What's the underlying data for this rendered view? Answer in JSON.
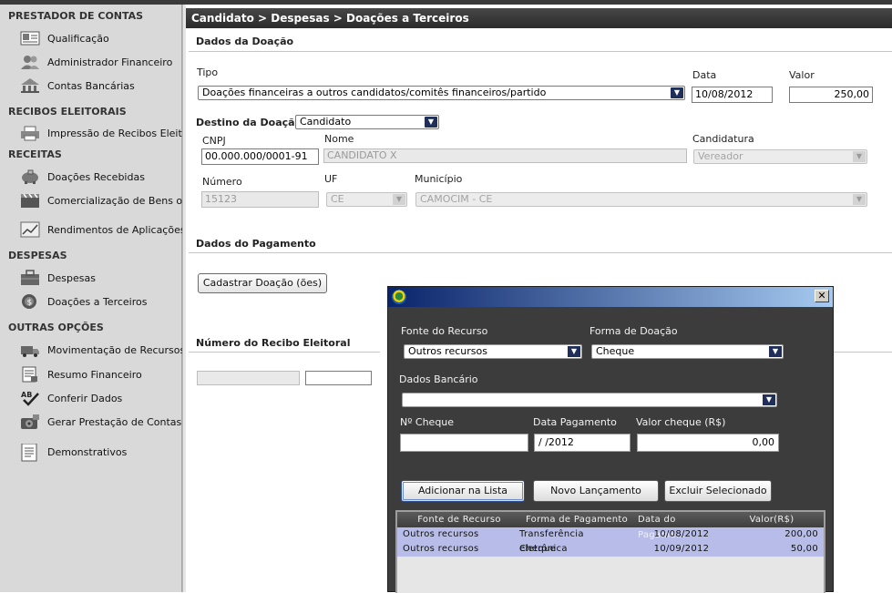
{
  "sidebar": {
    "sections": [
      {
        "title": "PRESTADOR DE CONTAS",
        "items": [
          {
            "label": "Qualificação",
            "icon": "id-card-icon"
          },
          {
            "label": "Administrador Financeiro",
            "icon": "users-icon"
          },
          {
            "label": "Contas Bancárias",
            "icon": "bank-icon"
          }
        ]
      },
      {
        "title": "RECIBOS ELEITORAIS",
        "items": [
          {
            "label": "Impressão de Recibos Eleitora",
            "icon": "printer-icon"
          }
        ]
      },
      {
        "title": "RECEITAS",
        "items": [
          {
            "label": "Doações Recebidas",
            "icon": "piggy-bank-icon"
          },
          {
            "label": "Comercialização de Bens ou R",
            "icon": "clapperboard-icon"
          },
          {
            "label": "Rendimentos de Aplicações Fi",
            "icon": "chart-icon"
          }
        ]
      },
      {
        "title": "DESPESAS",
        "items": [
          {
            "label": "Despesas",
            "icon": "briefcase-icon"
          },
          {
            "label": "Doações a Terceiros",
            "icon": "coin-icon"
          }
        ]
      },
      {
        "title": "OUTRAS OPÇÕES",
        "items": [
          {
            "label": "Movimentação de Recursos",
            "icon": "truck-icon"
          },
          {
            "label": "Resumo Financeiro",
            "icon": "report-icon"
          },
          {
            "label": "Conferir Dados",
            "icon": "spellcheck-icon"
          },
          {
            "label": "Gerar Prestação de Contas",
            "icon": "disk-icon"
          },
          {
            "label": "Demonstrativos",
            "icon": "document-icon"
          }
        ]
      }
    ]
  },
  "main": {
    "breadcrumb": "Candidato > Despesas > Doações a Terceiros",
    "dados_doacao": {
      "heading": "Dados da Doação",
      "tipo_label": "Tipo",
      "tipo_value": "Doações financeiras a outros candidatos/comitês financeiros/partido",
      "data_label": "Data",
      "data_value": "10/08/2012",
      "valor_label": "Valor",
      "valor_value": "250,00"
    },
    "destino": {
      "heading": "Destino da Doação",
      "select_value": "Candidato",
      "cnpj_label": "CNPJ",
      "cnpj_value": "00.000.000/0001-91",
      "nome_label": "Nome",
      "nome_value": "CANDIDATO X",
      "candidatura_label": "Candidatura",
      "candidatura_value": "Vereador",
      "numero_label": "Número",
      "numero_value": "15123",
      "uf_label": "UF",
      "uf_value": "CE",
      "municipio_label": "Município",
      "municipio_value": "CAMOCIM - CE"
    },
    "pagamento": {
      "heading": "Dados do Pagamento",
      "button": "Cadastrar Doação (ões)"
    },
    "recibo": {
      "heading": "Número do Recibo Eleitoral"
    }
  },
  "dialog": {
    "fonte_label": "Fonte do Recurso",
    "fonte_value": "Outros recursos",
    "forma_label": "Forma de Doação",
    "forma_value": "Cheque",
    "banco_label": "Dados Bancário",
    "banco_value": "",
    "cheque_label": "Nº Cheque",
    "cheque_value": "",
    "data_label": "Data Pagamento",
    "data_value": " /  /2012",
    "valor_label": "Valor cheque (R$)",
    "valor_value": "0,00",
    "btn_add": "Adicionar na Lista",
    "btn_new": "Novo Lançamento",
    "btn_del": "Excluir Selecionado",
    "close": "✕",
    "table": {
      "headers": [
        "Fonte de Recurso",
        "Forma de Pagamento",
        "Data do Pagame...",
        "Valor(R$)"
      ],
      "rows": [
        [
          "Outros recursos",
          "Transferência eletrônica",
          "10/08/2012",
          "200,00"
        ],
        [
          "Outros recursos",
          "Cheque",
          "10/09/2012",
          "50,00"
        ]
      ]
    }
  }
}
